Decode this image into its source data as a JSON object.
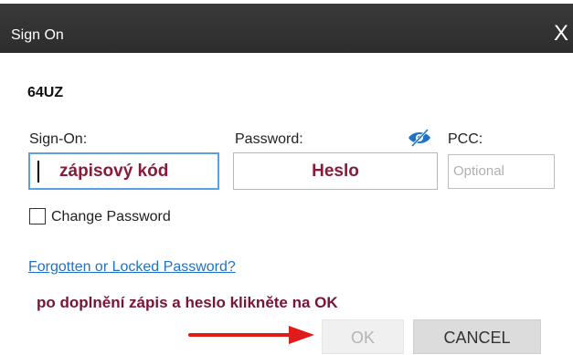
{
  "window": {
    "title": "Sign On",
    "close_icon": "close-icon",
    "close_glyph": "X"
  },
  "agency_code": "64UZ",
  "fields": {
    "signon": {
      "label": "Sign-On:",
      "value": "zápisový kód"
    },
    "password": {
      "label": "Password:",
      "value": "Heslo",
      "toggle_icon": "eye-slash-icon"
    },
    "pcc": {
      "label": "PCC:",
      "placeholder": "Optional"
    }
  },
  "change_password": {
    "label": "Change Password",
    "checked": false
  },
  "forgot_link": "Forgotten or Locked Password?",
  "instruction": "po doplnění zápis a heslo klikněte na OK",
  "buttons": {
    "ok": "OK",
    "cancel": "CANCEL"
  },
  "colors": {
    "titlebar": "#333333",
    "accent_blue": "#1e73c9",
    "annotation_text": "#7a1437",
    "arrow": "#e01b1b"
  }
}
